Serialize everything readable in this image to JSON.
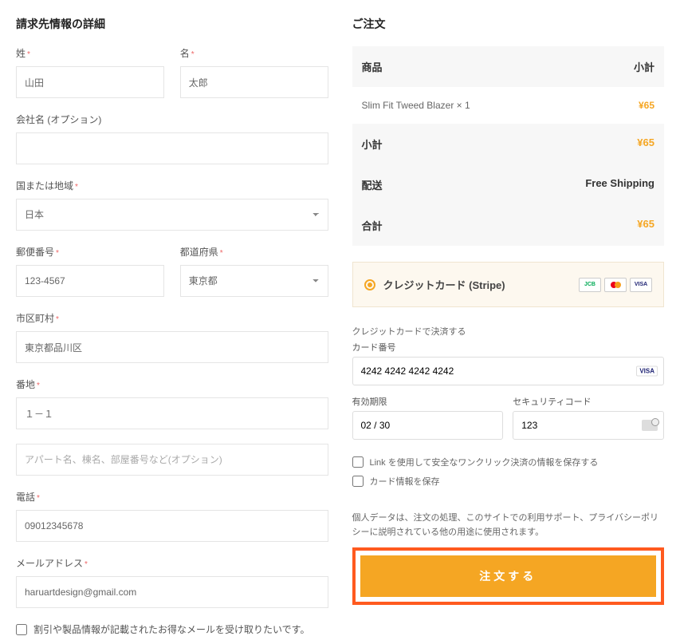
{
  "billing": {
    "title": "請求先情報の詳細",
    "last_name_label": "姓",
    "last_name": "山田",
    "first_name_label": "名",
    "first_name": "太郎",
    "company_label": "会社名 (オプション)",
    "company": "",
    "country_label": "国または地域",
    "country": "日本",
    "postcode_label": "郵便番号",
    "postcode": "123-4567",
    "state_label": "都道府県",
    "state": "東京都",
    "city_label": "市区町村",
    "city": "東京都品川区",
    "address1_label": "番地",
    "address1": "１－１",
    "address2_placeholder": "アパート名、棟名、部屋番号など(オプション)",
    "phone_label": "電話",
    "phone": "09012345678",
    "email_label": "メールアドレス",
    "email": "haruartdesign@gmail.com",
    "optin_label": "割引や製品情報が記載されたお得なメールを受け取りたいです。"
  },
  "order": {
    "title": "ご注文",
    "head_product": "商品",
    "head_subtotal": "小計",
    "item_name": "Slim Fit Tweed Blazer  × 1",
    "item_price": "¥65",
    "subtotal_label": "小計",
    "subtotal": "¥65",
    "shipping_label": "配送",
    "shipping": "Free Shipping",
    "total_label": "合計",
    "total": "¥65"
  },
  "payment": {
    "method_label": "クレジットカード (Stripe)",
    "logos": {
      "jcb": "JCB",
      "visa": "VISA"
    },
    "cc_desc": "クレジットカードで決済する",
    "card_number_label": "カード番号",
    "card_number": "4242 4242 4242 4242",
    "expiry_label": "有効期限",
    "expiry": "02 / 30",
    "cvc_label": "セキュリティコード",
    "cvc": "123",
    "link_label": "Link を使用して安全なワンクリック決済の情報を保存する",
    "save_label": "カード情報を保存"
  },
  "privacy": "個人データは、注文の処理、このサイトでの利用サポート、プライバシーポリシーに説明されている他の用途に使用されます。",
  "submit": "注文する"
}
